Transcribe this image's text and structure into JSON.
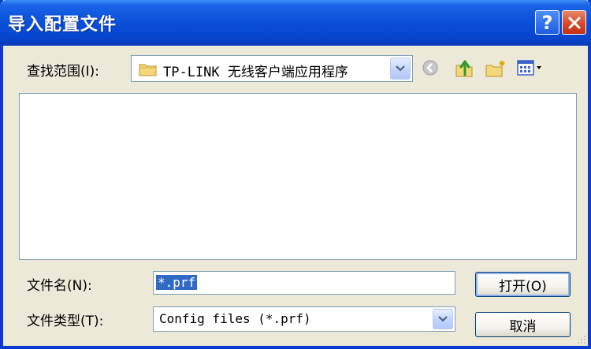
{
  "window": {
    "title": "导入配置文件",
    "help_glyph": "?"
  },
  "lookin": {
    "label": "查找范围(I):",
    "value": "TP-LINK 无线客户端应用程序"
  },
  "toolbar": {
    "icons": [
      "back-icon",
      "up-folder-icon",
      "new-folder-icon",
      "view-menu-icon"
    ]
  },
  "filename": {
    "label": "文件名(N):",
    "value": "*.prf"
  },
  "filetype": {
    "label": "文件类型(T):",
    "value": "Config files (*.prf)"
  },
  "buttons": {
    "open": "打开(O)",
    "cancel": "取消"
  },
  "colors": {
    "titlebar": "#0a4fd8",
    "dialog_bg": "#ece9d8",
    "selection": "#316ac5",
    "close_button": "#d64424"
  }
}
